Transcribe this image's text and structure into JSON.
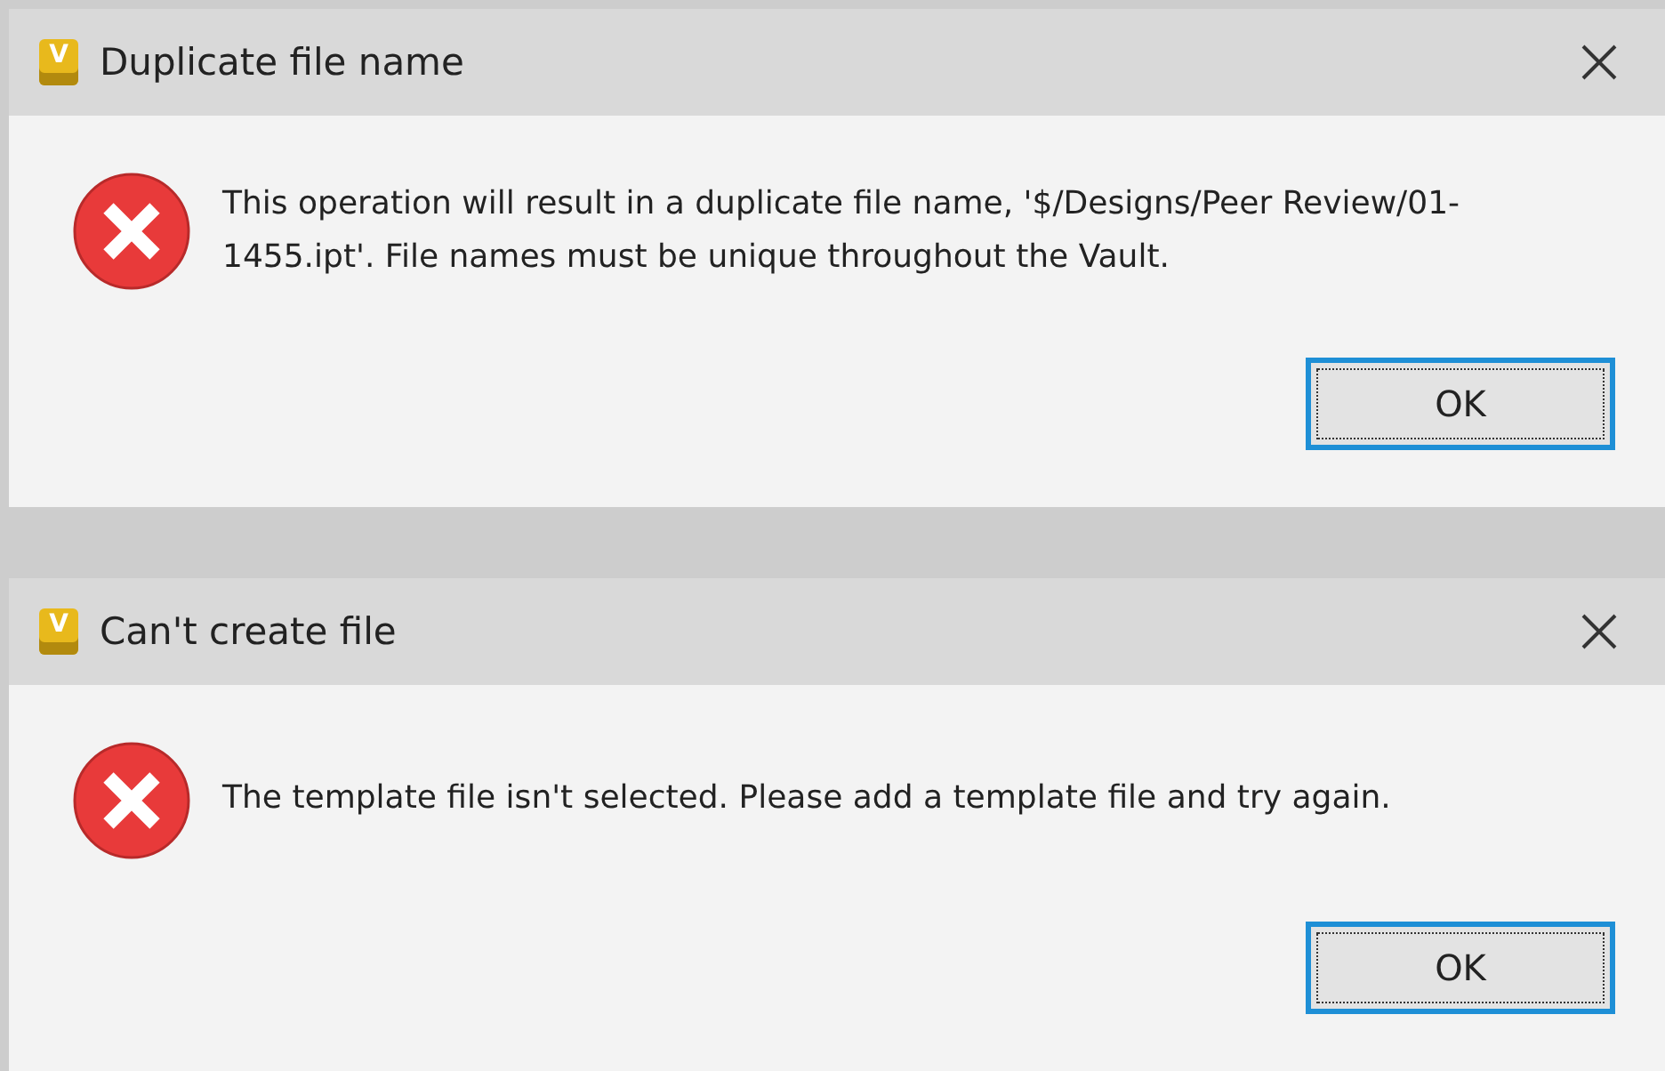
{
  "dialogs": [
    {
      "title": "Duplicate file name",
      "logo_letter": "V",
      "message": "This operation will result in a duplicate file name, '$/Designs/Peer Review/01-1455.ipt'. File names must be unique throughout the Vault.",
      "button": {
        "label": "OK",
        "focused": true
      }
    },
    {
      "title": "Can't create file",
      "logo_letter": "V",
      "message": "The template file isn't selected. Please add a template file and try again.",
      "button": {
        "label": "OK",
        "focused": true
      }
    }
  ]
}
